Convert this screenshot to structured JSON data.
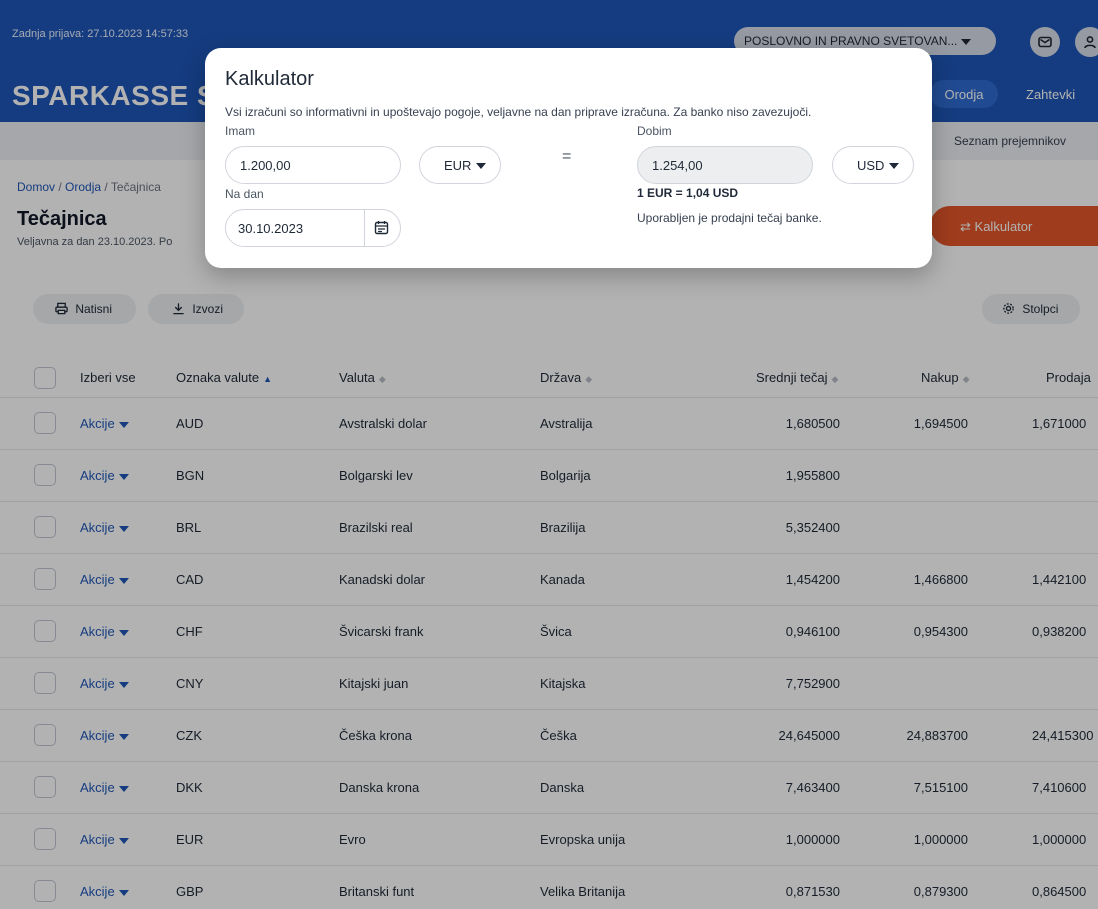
{
  "header": {
    "last_login": "Zadnja prijava: 27.10.2023 14:57:33",
    "org_select": "POSLOVNO IN PRAVNO SVETOVAN...",
    "mail_icon": "mail-icon",
    "user_icon": "user-icon",
    "logo_text": "SPARKASSE S",
    "nav": {
      "orodja": "Orodja",
      "zahtevki": "Zahtevki"
    },
    "sub_nav": {
      "seznam": "Seznam prejemnikov"
    },
    "colors": {
      "brand_blue": "#1f56b8",
      "accent_orange": "#e4572a"
    }
  },
  "page": {
    "breadcrumb": {
      "home": "Domov",
      "sep": "/",
      "tools": "Orodja",
      "current": "Tečajnica"
    },
    "title": "Tečajnica",
    "subtitle": "Veljavna za dan 23.10.2023. Po",
    "calculator_button": "Kalkulator"
  },
  "toolbar": {
    "print": "Natisni",
    "export": "Izvozi",
    "columns": "Stolpci"
  },
  "table": {
    "headers": {
      "select_all": "Izberi vse",
      "code": "Oznaka valute",
      "currency": "Valuta",
      "country": "Država",
      "mid": "Srednji tečaj",
      "buy": "Nakup",
      "sell": "Prodaja"
    },
    "action_label": "Akcije",
    "rows": [
      {
        "code": "AUD",
        "currency": "Avstralski dolar",
        "country": "Avstralija",
        "mid": "1,680500",
        "buy": "1,694500",
        "sell": "1,671000"
      },
      {
        "code": "BGN",
        "currency": "Bolgarski lev",
        "country": "Bolgarija",
        "mid": "1,955800",
        "buy": "",
        "sell": ""
      },
      {
        "code": "BRL",
        "currency": "Brazilski real",
        "country": "Brazilija",
        "mid": "5,352400",
        "buy": "",
        "sell": ""
      },
      {
        "code": "CAD",
        "currency": "Kanadski dolar",
        "country": "Kanada",
        "mid": "1,454200",
        "buy": "1,466800",
        "sell": "1,442100"
      },
      {
        "code": "CHF",
        "currency": "Švicarski frank",
        "country": "Švica",
        "mid": "0,946100",
        "buy": "0,954300",
        "sell": "0,938200"
      },
      {
        "code": "CNY",
        "currency": "Kitajski juan",
        "country": "Kitajska",
        "mid": "7,752900",
        "buy": "",
        "sell": ""
      },
      {
        "code": "CZK",
        "currency": "Češka krona",
        "country": "Češka",
        "mid": "24,645000",
        "buy": "24,883700",
        "sell": "24,415300"
      },
      {
        "code": "DKK",
        "currency": "Danska krona",
        "country": "Danska",
        "mid": "7,463400",
        "buy": "7,515100",
        "sell": "7,410600"
      },
      {
        "code": "EUR",
        "currency": "Evro",
        "country": "Evropska unija",
        "mid": "1,000000",
        "buy": "1,000000",
        "sell": "1,000000"
      },
      {
        "code": "GBP",
        "currency": "Britanski funt",
        "country": "Velika Britanija",
        "mid": "0,871530",
        "buy": "0,879300",
        "sell": "0,864500"
      }
    ]
  },
  "modal": {
    "title": "Kalkulator",
    "description": "Vsi izračuni so informativni in upoštevajo pogoje, veljavne na dan priprave izračuna. Za banko niso zavezujoči.",
    "have_label": "Imam",
    "have_value": "1.200,00",
    "have_currency": "EUR",
    "equals": "=",
    "get_label": "Dobim",
    "get_value": "1.254,00",
    "get_currency": "USD",
    "date_label": "Na dan",
    "date_value": "30.10.2023",
    "rate": "1 EUR = 1,04 USD",
    "note": "Uporabljen je prodajni tečaj banke."
  }
}
